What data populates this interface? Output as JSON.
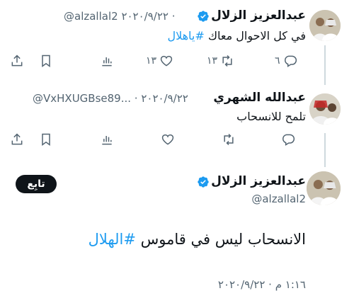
{
  "tweet1": {
    "display_name": "عبدالعزيز الزلال",
    "handle_date": "@alzallal2 ٢٠٢٠/٩/٢٢ ·",
    "text_plain": "في كل الاحوال معاك ",
    "hashtag": "#ياهلال",
    "replies": "٦",
    "retweets": "١٣",
    "likes": "١٣"
  },
  "tweet2": {
    "display_name": "عبدالله الشهري",
    "handle_date": "@VxHXUGBse89... · ٢٠٢٠/٩/٢٢",
    "text": "تلمح للانسحاب"
  },
  "tweet3": {
    "display_name": "عبدالعزيز الزلال",
    "handle": "@alzallal2",
    "follow_label": "تابِع",
    "text_plain": "الانسحاب ليس في قاموس ",
    "hashtag": "#الهلال",
    "timestamp": "١:١٦ م · ٢٠٢٠/٩/٢٢"
  },
  "colors": {
    "accent": "#1d9bf0",
    "text": "#0f1419",
    "muted": "#536471",
    "line": "#cfd9de"
  },
  "icons": [
    "verified-badge-icon",
    "reply-icon",
    "retweet-icon",
    "like-icon",
    "views-icon",
    "bookmark-icon",
    "share-icon"
  ]
}
